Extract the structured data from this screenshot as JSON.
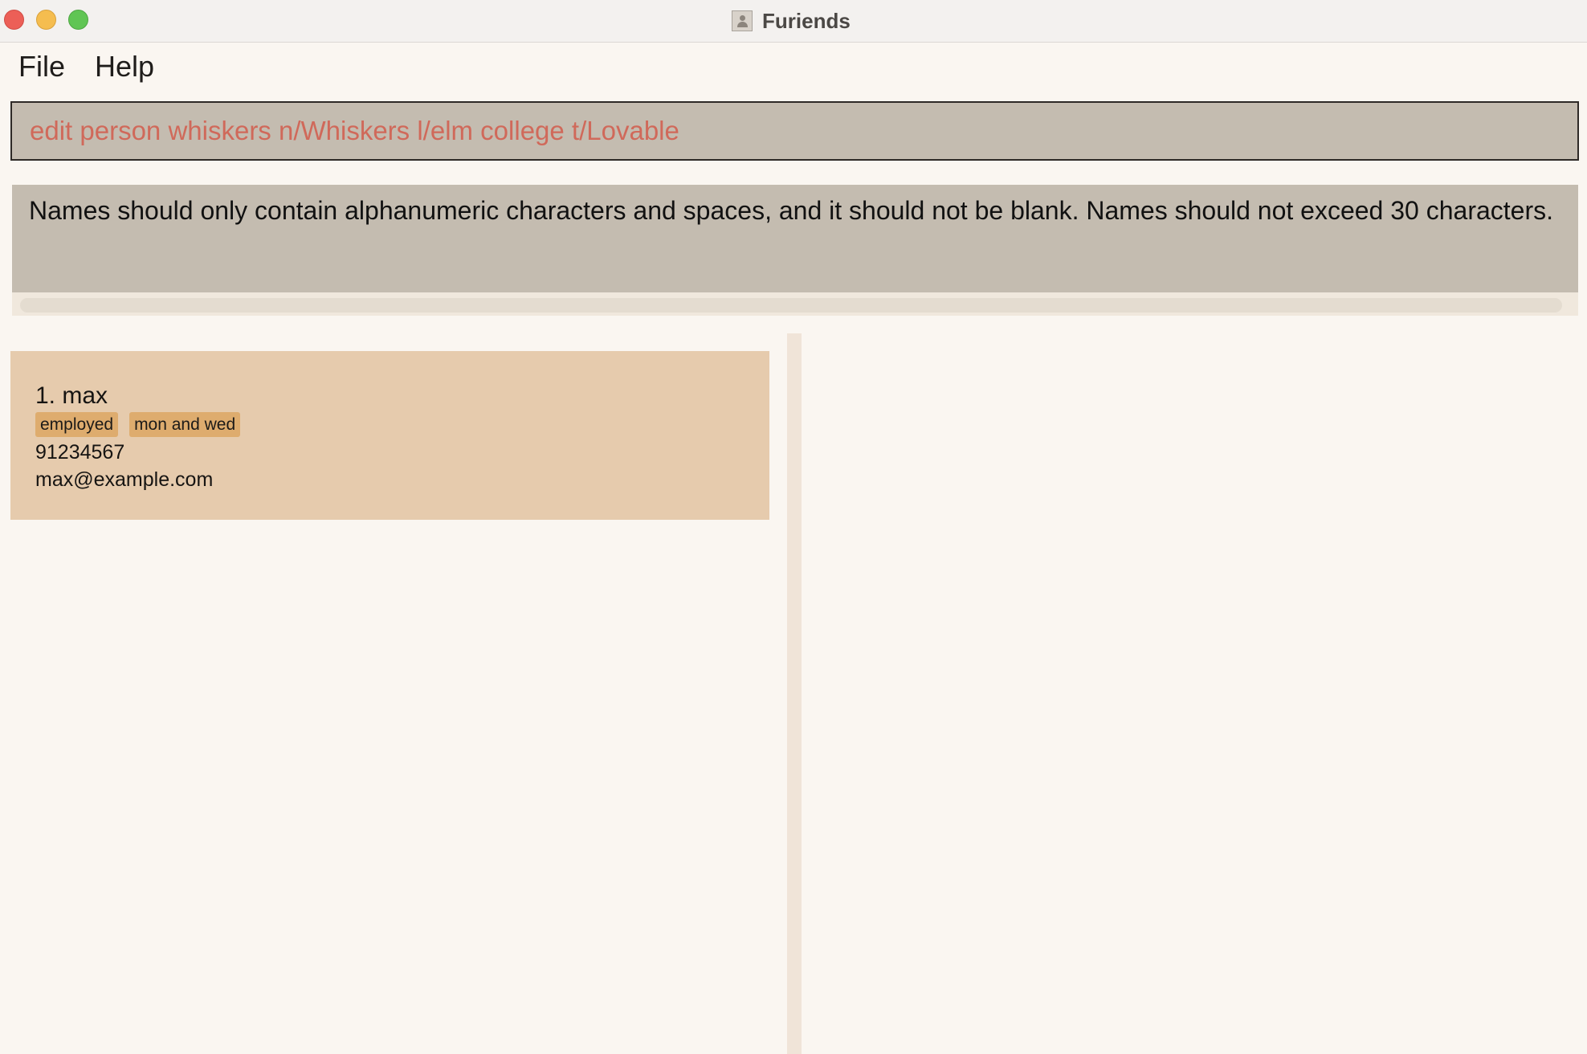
{
  "window": {
    "title": "Furiends",
    "controls": [
      "close",
      "minimize",
      "maximize"
    ]
  },
  "menu": {
    "items": [
      "File",
      "Help"
    ]
  },
  "command": {
    "value": "edit person whiskers n/Whiskers l/elm college t/Lovable"
  },
  "result": {
    "message": "Names should only contain alphanumeric characters and spaces, and it should not be blank. Names should not exceed 30 characters."
  },
  "persons": [
    {
      "index_name": "1. max",
      "tags": [
        "employed",
        "mon and wed"
      ],
      "phone": "91234567",
      "email": "max@example.com"
    }
  ],
  "colors": {
    "command_text_error": "#d0695a",
    "command_bg": "#c4bcb0",
    "card_bg": "#e6cbad",
    "tag_bg": "#deac6e",
    "window_bg": "#faf6f1"
  },
  "icons": {
    "app_icon": "contacts-app-icon"
  }
}
